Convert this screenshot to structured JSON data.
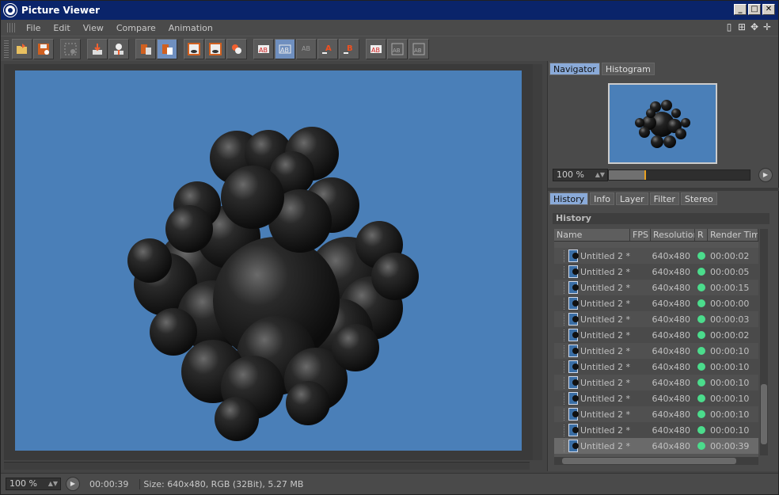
{
  "window": {
    "title": "Picture Viewer",
    "minimize": "_",
    "maximize": "□",
    "close": "✕"
  },
  "menu": {
    "items": [
      "File",
      "Edit",
      "View",
      "Compare",
      "Animation"
    ]
  },
  "navigator": {
    "tabs": [
      "Navigator",
      "Histogram"
    ],
    "zoom": "100 %",
    "zoom_fraction": 0.25
  },
  "info_tabs": [
    "History",
    "Info",
    "Layer",
    "Filter",
    "Stereo"
  ],
  "history": {
    "title": "History",
    "columns": [
      "Name",
      "FPS",
      "Resolution",
      "R",
      "Render Tim"
    ],
    "rows": [
      {
        "name": "Untitled 2 *",
        "fps": "",
        "res": "640x480",
        "time": "00:00:02"
      },
      {
        "name": "Untitled 2 *",
        "fps": "",
        "res": "640x480",
        "time": "00:00:05"
      },
      {
        "name": "Untitled 2 *",
        "fps": "",
        "res": "640x480",
        "time": "00:00:15"
      },
      {
        "name": "Untitled 2 *",
        "fps": "",
        "res": "640x480",
        "time": "00:00:00"
      },
      {
        "name": "Untitled 2 *",
        "fps": "",
        "res": "640x480",
        "time": "00:00:03"
      },
      {
        "name": "Untitled 2 *",
        "fps": "",
        "res": "640x480",
        "time": "00:00:02"
      },
      {
        "name": "Untitled 2 *",
        "fps": "",
        "res": "640x480",
        "time": "00:00:10"
      },
      {
        "name": "Untitled 2 *",
        "fps": "",
        "res": "640x480",
        "time": "00:00:10"
      },
      {
        "name": "Untitled 2 *",
        "fps": "",
        "res": "640x480",
        "time": "00:00:10"
      },
      {
        "name": "Untitled 2 *",
        "fps": "",
        "res": "640x480",
        "time": "00:00:10"
      },
      {
        "name": "Untitled 2 *",
        "fps": "",
        "res": "640x480",
        "time": "00:00:10"
      },
      {
        "name": "Untitled 2 *",
        "fps": "",
        "res": "640x480",
        "time": "00:00:10"
      },
      {
        "name": "Untitled 2 *",
        "fps": "",
        "res": "640x480",
        "time": "00:00:39"
      }
    ]
  },
  "status": {
    "zoom": "100 %",
    "time": "00:00:39",
    "info": "Size: 640x480, RGB (32Bit), 5.27 MB"
  },
  "colors": {
    "render_bg": "#4a7fb8",
    "accent": "#8aaad8",
    "status_dot": "#4bdc8c"
  }
}
